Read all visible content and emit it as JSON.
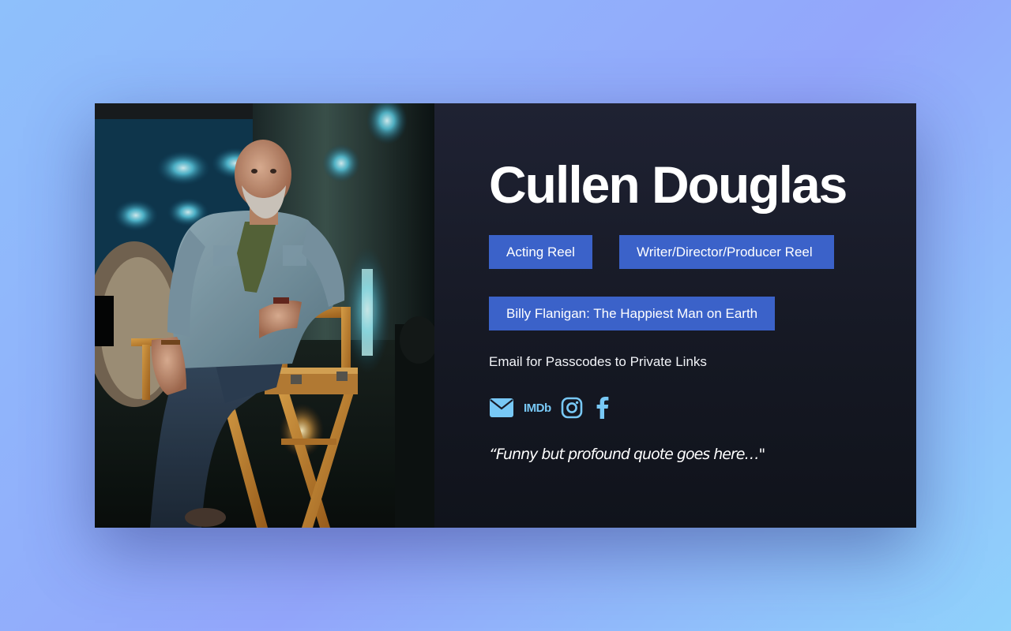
{
  "profile": {
    "name": "Cullen Douglas",
    "photo_alt": "Cullen Douglas seated in a director's chair on a film set"
  },
  "buttons": {
    "acting_reel": "Acting Reel",
    "writer_reel": "Writer/Director/Producer Reel",
    "billy_flanigan": "Billy Flanigan: The Happiest Man on Earth"
  },
  "email_note": "Email for Passcodes to Private Links",
  "social": {
    "imdb_label": "IMDb",
    "icons": [
      "envelope-icon",
      "imdb-icon",
      "instagram-icon",
      "facebook-icon"
    ],
    "icon_color": "#78c8f5"
  },
  "quote": "“Funny but profound quote goes here…\"",
  "colors": {
    "button_bg": "#3b62c9",
    "panel_bg": "#181b27",
    "page_gradient": [
      "#8ec0fb",
      "#93a6fb",
      "#8fd2fb"
    ]
  }
}
